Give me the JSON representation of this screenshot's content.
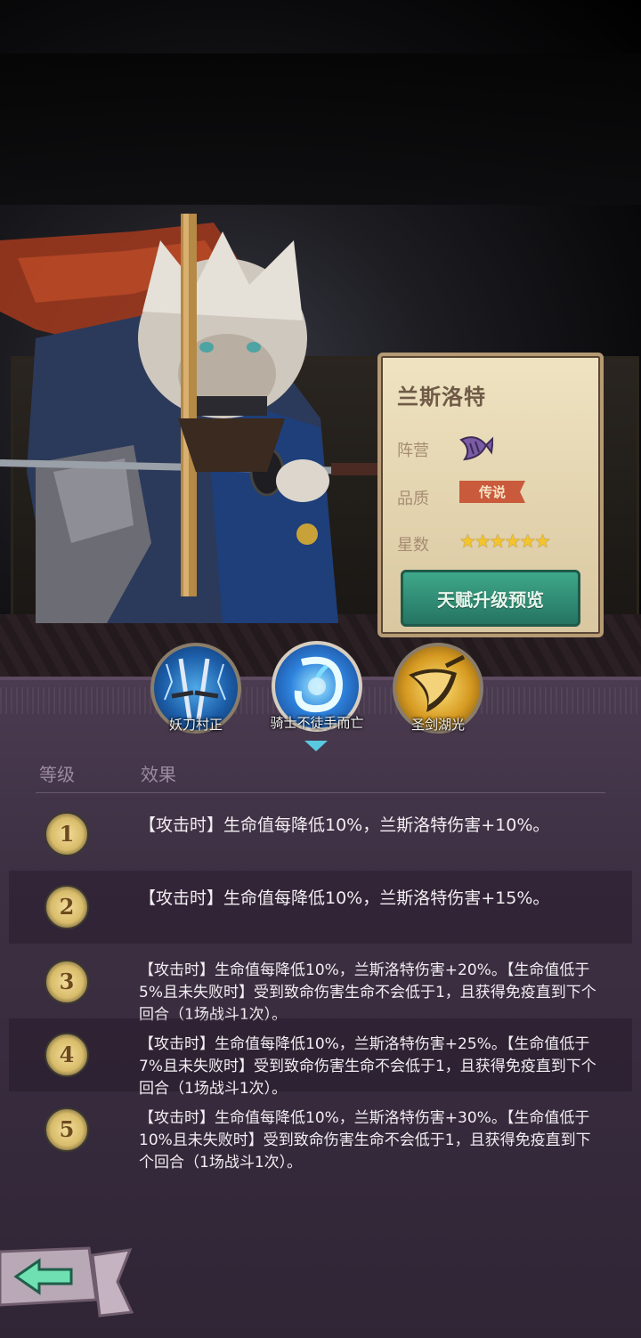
{
  "hero": {
    "name": "兰斯洛特",
    "faction_label": "阵营",
    "faction_icon": "fish-icon",
    "quality_label": "品质",
    "quality_value": "传说",
    "stars_label": "星数",
    "stars": "★★★★★★",
    "talent_button": "天赋升级预览"
  },
  "skills": [
    {
      "label": "妖刀村正",
      "icon": "swords-icon"
    },
    {
      "label": "骑士不徒手而亡",
      "icon": "swirl-icon"
    },
    {
      "label": "圣剑湖光",
      "icon": "blade-icon"
    }
  ],
  "selected_skill_index": 1,
  "table": {
    "header_level": "等级",
    "header_effect": "效果",
    "rows": [
      {
        "level": "1",
        "effect": "【攻击时】生命值每降低10%，兰斯洛特伤害+10%。"
      },
      {
        "level": "2",
        "effect": "【攻击时】生命值每降低10%，兰斯洛特伤害+15%。"
      },
      {
        "level": "3",
        "effect": "【攻击时】生命值每降低10%，兰斯洛特伤害+20%。【生命值低于5%且未失败时】受到致命伤害生命不会低于1，且获得免疫直到下个回合（1场战斗1次）。"
      },
      {
        "level": "4",
        "effect": "【攻击时】生命值每降低10%，兰斯洛特伤害+25%。【生命值低于7%且未失败时】受到致命伤害生命不会低于1，且获得免疫直到下个回合（1场战斗1次）。"
      },
      {
        "level": "5",
        "effect": "【攻击时】生命值每降低10%，兰斯洛特伤害+30%。【生命值低于10%且未失败时】受到致命伤害生命不会低于1，且获得免疫直到下个回合（1场战斗1次）。"
      }
    ]
  },
  "back_icon": "back-arrow-icon",
  "colors": {
    "panel": "#3d3043",
    "accent_green": "#3ea88a",
    "gold": "#f4c42c"
  }
}
